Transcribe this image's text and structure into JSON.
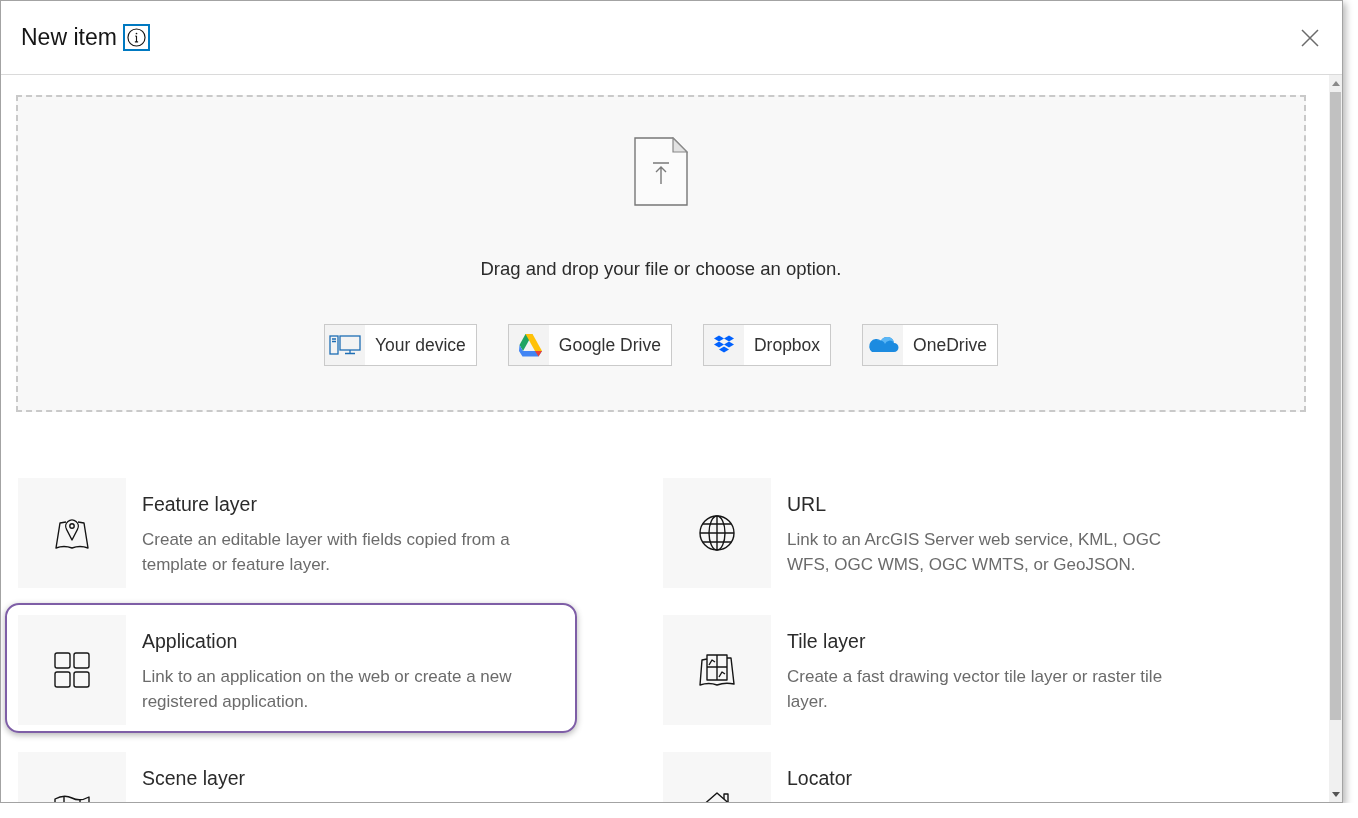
{
  "dialog": {
    "title": "New item",
    "info_button": {
      "focused": true
    }
  },
  "upload": {
    "prompt": "Drag and drop your file or choose an option.",
    "sources": [
      {
        "label": "Your device",
        "kind": "device"
      },
      {
        "label": "Google Drive",
        "kind": "google_drive"
      },
      {
        "label": "Dropbox",
        "kind": "dropbox"
      },
      {
        "label": "OneDrive",
        "kind": "onedrive"
      }
    ]
  },
  "item_types": [
    {
      "kind": "feature_layer",
      "title": "Feature layer",
      "description": "Create an editable layer with fields copied from a template or feature layer.",
      "selected": false
    },
    {
      "kind": "url",
      "title": "URL",
      "description": "Link to an ArcGIS Server web service, KML, OGC WFS, OGC WMS, OGC WMTS, or GeoJSON.",
      "selected": false
    },
    {
      "kind": "application",
      "title": "Application",
      "description": "Link to an application on the web or create a new registered application.",
      "selected": true
    },
    {
      "kind": "tile_layer",
      "title": "Tile layer",
      "description": "Create a fast drawing vector tile layer or raster tile layer.",
      "selected": false
    },
    {
      "kind": "scene_layer",
      "title": "Scene layer",
      "selected": false
    },
    {
      "kind": "locator",
      "title": "Locator",
      "selected": false
    }
  ]
}
